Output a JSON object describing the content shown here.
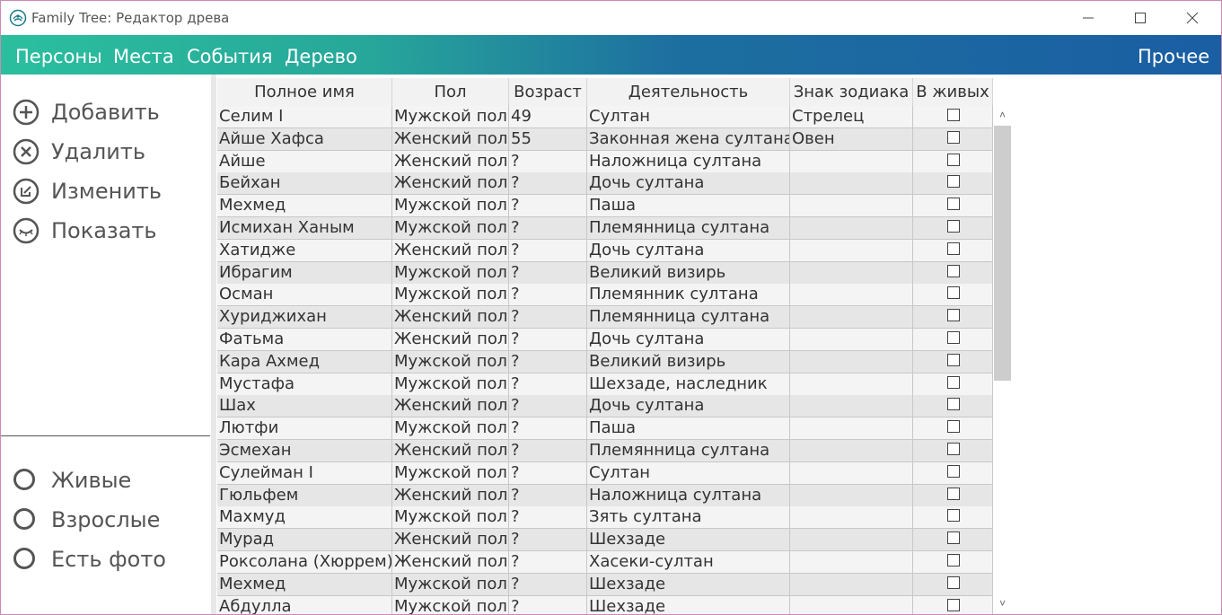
{
  "window": {
    "title": "Family Tree: Редактор древа"
  },
  "menubar": {
    "items": [
      "Персоны",
      "Места",
      "События",
      "Дерево"
    ],
    "right_item": "Прочее"
  },
  "sidebar": {
    "actions": [
      {
        "label": "Добавить",
        "icon": "plus-circle-icon"
      },
      {
        "label": "Удалить",
        "icon": "x-circle-icon"
      },
      {
        "label": "Изменить",
        "icon": "edit-circle-icon"
      },
      {
        "label": "Показать",
        "icon": "eye-circle-icon"
      }
    ],
    "filters": [
      {
        "label": "Живые",
        "checked": false
      },
      {
        "label": "Взрослые",
        "checked": false
      },
      {
        "label": "Есть фото",
        "checked": false
      }
    ]
  },
  "table": {
    "columns": [
      "Полное имя",
      "Пол",
      "Возраст",
      "Деятельность",
      "Знак зодиака",
      "В живых"
    ],
    "rows": [
      [
        "Селим I",
        "Мужской пол",
        "49",
        "Султан",
        "Стрелец",
        false
      ],
      [
        "Айше Хафса",
        "Женский пол",
        "55",
        "Законная жена султана",
        "Овен",
        false
      ],
      [
        "Айше",
        "Женский пол",
        "?",
        "Наложница султана",
        "",
        false
      ],
      [
        "Бейхан",
        "Женский пол",
        "?",
        "Дочь султана",
        "",
        false
      ],
      [
        "Мехмед",
        "Мужской пол",
        "?",
        "Паша",
        "",
        false
      ],
      [
        "Исмихан Ханым",
        "Мужской пол",
        "?",
        "Племянница султана",
        "",
        false
      ],
      [
        "Хатидже",
        "Женский пол",
        "?",
        "Дочь султана",
        "",
        false
      ],
      [
        "Ибрагим",
        "Мужской пол",
        "?",
        "Великий визирь",
        "",
        false
      ],
      [
        "Осман",
        "Мужской пол",
        "?",
        "Племянник султана",
        "",
        false
      ],
      [
        "Хуриджихан",
        "Женский пол",
        "?",
        "Племянница султана",
        "",
        false
      ],
      [
        "Фатьма",
        "Женский пол",
        "?",
        "Дочь султана",
        "",
        false
      ],
      [
        "Кара Ахмед",
        "Мужской пол",
        "?",
        "Великий визирь",
        "",
        false
      ],
      [
        "Мустафа",
        "Мужской пол",
        "?",
        "Шехзаде, наследник",
        "",
        false
      ],
      [
        "Шах",
        "Женский пол",
        "?",
        "Дочь султана",
        "",
        false
      ],
      [
        "Лютфи",
        "Мужской пол",
        "?",
        "Паша",
        "",
        false
      ],
      [
        "Эсмехан",
        "Женский пол",
        "?",
        "Племянница султана",
        "",
        false
      ],
      [
        "Сулейман I",
        "Мужской пол",
        "?",
        "Султан",
        "",
        false
      ],
      [
        "Гюльфем",
        "Женский пол",
        "?",
        "Наложница султана",
        "",
        false
      ],
      [
        "Махмуд",
        "Мужской пол",
        "?",
        "Зять султана",
        "",
        false
      ],
      [
        "Мурад",
        "Женский пол",
        "?",
        "Шехзаде",
        "",
        false
      ],
      [
        "Роксолана (Хюррем)",
        "Женский пол",
        "?",
        "Хасеки-султан",
        "",
        false
      ],
      [
        "Мехмед",
        "Мужской пол",
        "?",
        "Шехзаде",
        "",
        false
      ],
      [
        "Абдулла",
        "Мужской пол",
        "?",
        "Шехзаде",
        "",
        false
      ]
    ]
  },
  "colors": {
    "menubar_start": "#2bbf9e",
    "menubar_end": "#1a5ea3",
    "window_border": "#c98bb3"
  }
}
